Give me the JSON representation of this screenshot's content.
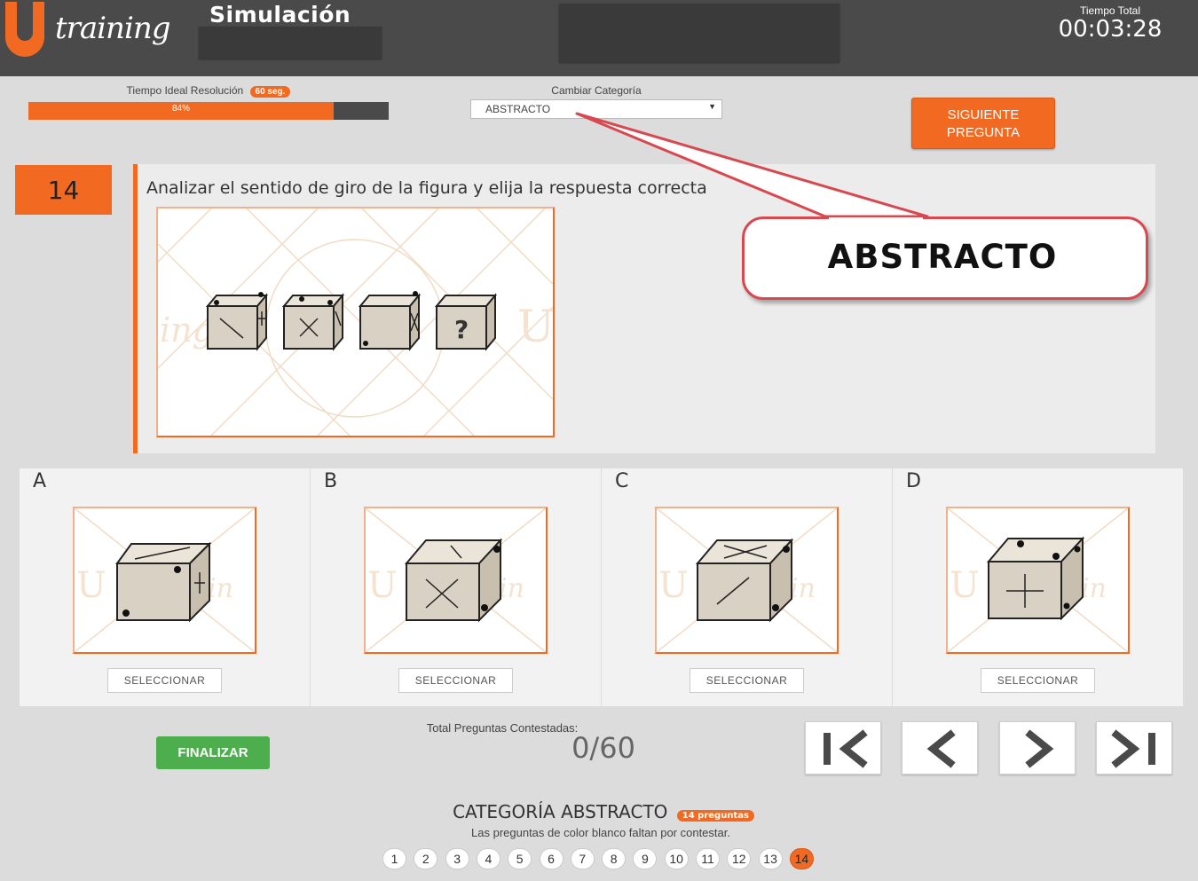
{
  "header": {
    "logo_text": "training",
    "title": "Simulación",
    "timer_label": "Tiempo Total",
    "timer_value": "00:03:28"
  },
  "ideal_time": {
    "label": "Tiempo Ideal Resolución",
    "badge": "60 seg.",
    "progress_text": "84%",
    "progress_fraction": 0.847
  },
  "category_select": {
    "label": "Cambiar Categoría",
    "selected": "ABSTRACTO"
  },
  "next_button": {
    "line1": "SIGUIENTE",
    "line2": "PREGUNTA"
  },
  "question": {
    "number": "14",
    "text": "Analizar el sentido de giro de la figura y elija la respuesta correcta",
    "sequence_marks": [
      "diagonal / plus",
      "x / diagonal",
      "dots / x",
      "?"
    ]
  },
  "callout": {
    "text": "ABSTRACTO"
  },
  "options": [
    {
      "letter": "A",
      "select_label": "SELECCIONAR"
    },
    {
      "letter": "B",
      "select_label": "SELECCIONAR"
    },
    {
      "letter": "C",
      "select_label": "SELECCIONAR"
    },
    {
      "letter": "D",
      "select_label": "SELECCIONAR"
    }
  ],
  "footer": {
    "finish_label": "FINALIZAR",
    "answered_label": "Total Preguntas Contestadas:",
    "answered_value": "0/60",
    "nav_icons": [
      "first-page-icon",
      "previous-icon",
      "next-icon",
      "last-page-icon"
    ]
  },
  "category_summary": {
    "title": "CATEGORÍA ABSTRACTO",
    "badge": "14 preguntas",
    "subtitle": "Las preguntas de color blanco faltan por contestar.",
    "pages": [
      "1",
      "2",
      "3",
      "4",
      "5",
      "6",
      "7",
      "8",
      "9",
      "10",
      "11",
      "12",
      "13",
      "14"
    ],
    "active_page": "14"
  },
  "colors": {
    "accent": "#f26a21",
    "header_bg": "#4a4a4a",
    "success": "#4cae4c",
    "callout_border": "#d9474f"
  }
}
